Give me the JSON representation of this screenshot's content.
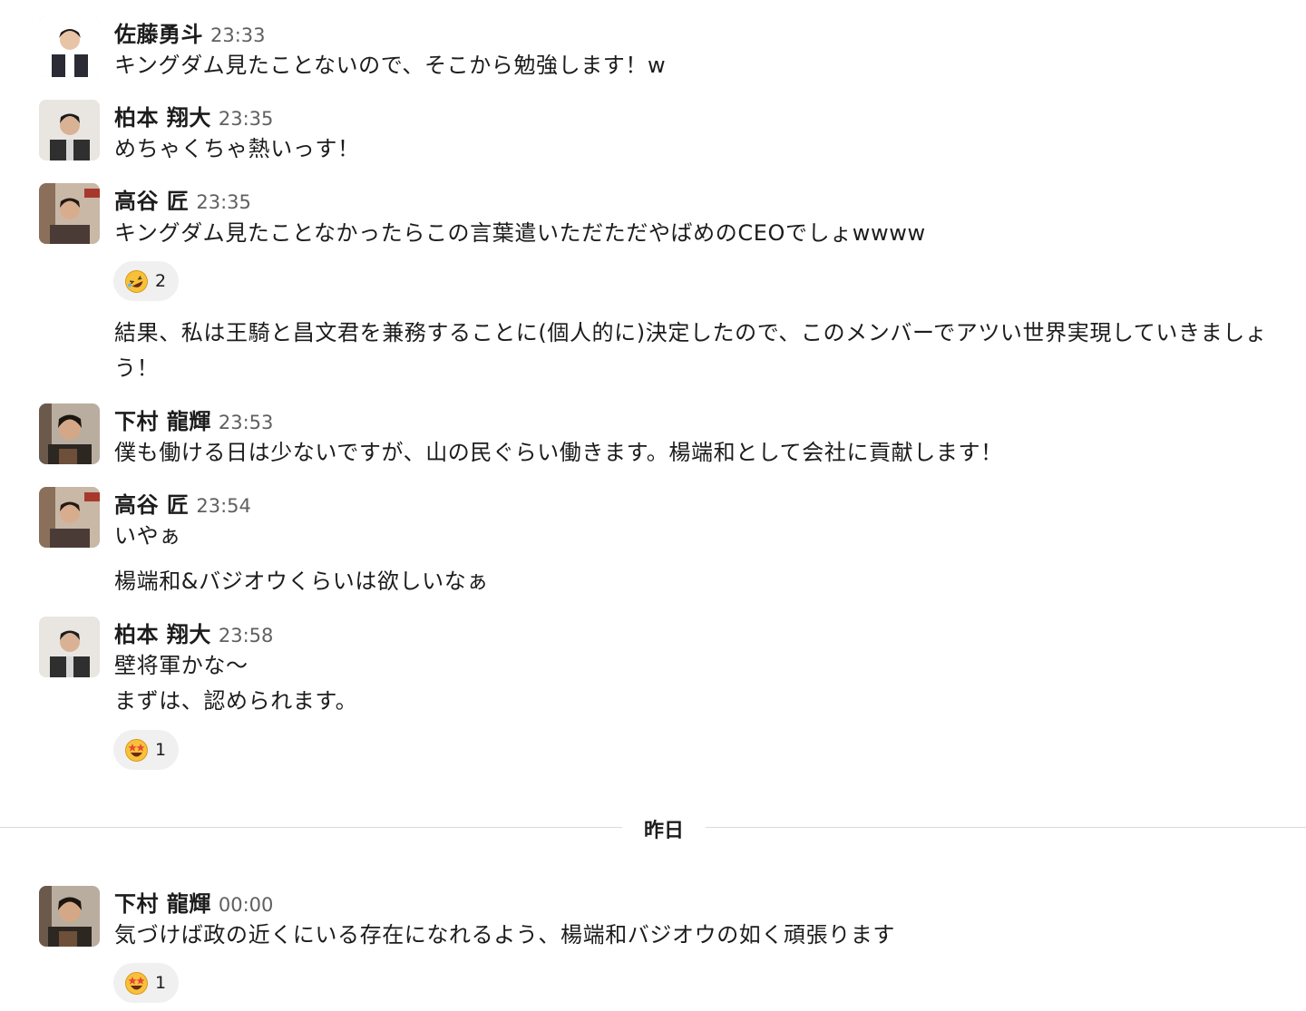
{
  "messages": [
    {
      "sender": "佐藤勇斗",
      "time": "23:33",
      "text": "キングダム見たことないので、そこから勉強します！w"
    },
    {
      "sender": "柏本 翔大",
      "time": "23:35",
      "text": "めちゃくちゃ熱いっす！"
    },
    {
      "sender": "高谷 匠",
      "time": "23:35",
      "text": "キングダム見たことなかったらこの言葉遣いただただやばめのCEOでしょwwww",
      "reaction": {
        "emoji": "rolling-on-floor-laughing",
        "count": "2"
      }
    },
    {
      "sender": "",
      "time": "",
      "text": "結果、私は王騎と昌文君を兼務することに(個人的に)決定したので、このメンバーでアツい世界実現していきましょう！"
    },
    {
      "sender": "下村 龍輝",
      "time": "23:53",
      "text": "僕も働ける日は少ないですが、山の民ぐらい働きます。楊端和として会社に貢献します！"
    },
    {
      "sender": "高谷 匠",
      "time": "23:54",
      "text": "いやぁ"
    },
    {
      "sender": "",
      "time": "",
      "text": "楊端和&バジオウくらいは欲しいなぁ"
    },
    {
      "sender": "柏本 翔大",
      "time": "23:58",
      "text_lines": [
        "壁将軍かな〜",
        "まずは、認められます。"
      ],
      "reaction": {
        "emoji": "star-struck",
        "count": "1"
      }
    },
    {
      "sender": "下村 龍輝",
      "time": "00:00",
      "text": "気づけば政の近くにいる存在になれるよう、楊端和バジオウの如く頑張ります",
      "reaction": {
        "emoji": "star-struck",
        "count": "1"
      }
    }
  ],
  "divider": {
    "label": "昨日"
  },
  "colors": {
    "text": "#1d1c1d",
    "timestamp": "#616061",
    "reaction_bg": "#f0f0f0",
    "divider": "#dcdcdc"
  }
}
